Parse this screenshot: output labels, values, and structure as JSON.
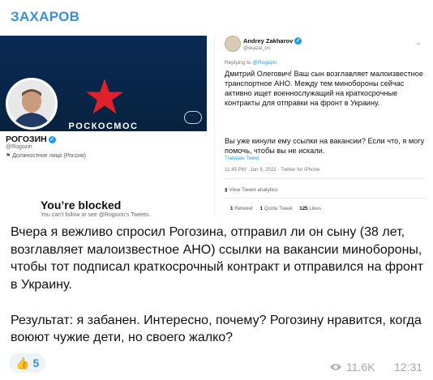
{
  "channel": {
    "name": "ЗАХАРОВ"
  },
  "screenshot_left": {
    "brand": "РОСКОСМОС",
    "profile_name": "РОГОЗИН",
    "profile_handle": "@Rogozin",
    "profile_role": "Должностное лицо (Россия)",
    "more_label": "···",
    "blocked_title": "You’re blocked",
    "blocked_sub": "You can’t follow or see @Rogozin’s Tweets."
  },
  "screenshot_right": {
    "author_name": "Andrey Zakharov",
    "author_handle": "@skazal_on",
    "replying_prefix": "Replying to",
    "replying_to": "@Rogozin",
    "body_1": "Дмитрий Олегович! Ваш сын возглавляет малоизвестное транспортное АНО. Между тем минобороны сейчас активно ищет военнослужащий на краткосрочные контракты для отправки на фронт в Украину.",
    "body_2": "Вы уже кинули ему ссылки на вакансии? Если что, я могу помочь, чтобы вы не искали.",
    "translate": "Translate Tweet",
    "meta": "11:45 PM · Jun 9, 2022 · Twitter for iPhone",
    "analytics": "View Tweet analytics",
    "retweets_count": "1",
    "retweets_label": "Retweet",
    "quotes_count": "1",
    "quotes_label": "Quote Tweet",
    "likes_count": "125",
    "likes_label": "Likes"
  },
  "message": {
    "paragraph_1": "Вчера я вежливо спросил Рогозина, отправил ли он сыну (38 лет, возглавляет малоизвестное АНО) ссылки на вакансии минобороны, чтобы тот подписал краткосрочный контракт и отправился на фронт в Украину.",
    "paragraph_2": "Результат: я забанен. Интересно, почему? Рогозину нравится, когда воюют чужие дети, но своего жалко?"
  },
  "reaction": {
    "emoji": "👍",
    "count": "5"
  },
  "footer": {
    "views": "11.6K",
    "time": "12:31"
  },
  "colors": {
    "accent": "#3a8fd6",
    "banner": "#0b2a55",
    "star": "#e0202a",
    "twitter_blue": "#1d9bf0"
  }
}
